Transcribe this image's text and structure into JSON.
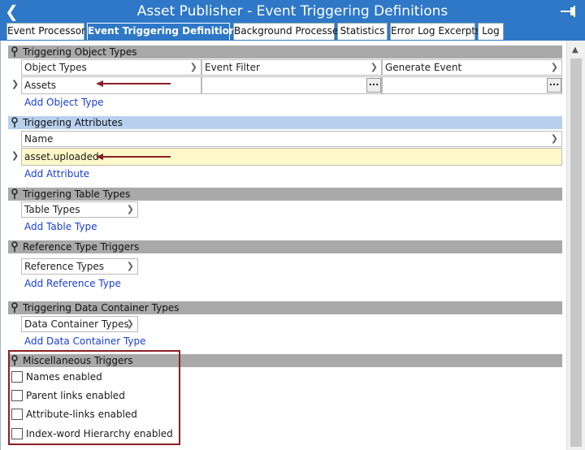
{
  "window": {
    "title": "Asset Publisher - Event Triggering Definitions"
  },
  "tabs": [
    {
      "label": "Event Processor"
    },
    {
      "label": "Event Triggering Definitions"
    },
    {
      "label": "Background Processes"
    },
    {
      "label": "Statistics"
    },
    {
      "label": "Error Log Excerpts"
    },
    {
      "label": "Log"
    }
  ],
  "sections": {
    "object_types": {
      "title": "Triggering Object Types",
      "columns": [
        "Object Types",
        "Event Filter",
        "Generate Event"
      ],
      "rows": [
        {
          "object_type": "Assets",
          "event_filter": "",
          "generate_event": ""
        }
      ],
      "dots": "...",
      "add_link": "Add Object Type"
    },
    "attributes": {
      "title": "Triggering Attributes",
      "columns": [
        "Name"
      ],
      "rows": [
        {
          "name": "asset.uploaded"
        }
      ],
      "add_link": "Add Attribute"
    },
    "table_types": {
      "title": "Triggering Table Types",
      "columns": [
        "Table Types"
      ],
      "add_link": "Add Table Type"
    },
    "reference_types": {
      "title": "Reference Type Triggers",
      "columns": [
        "Reference Types"
      ],
      "add_link": "Add Reference Type"
    },
    "data_container_types": {
      "title": "Triggering Data Container Types",
      "columns": [
        "Data Container Types"
      ],
      "add_link": "Add Data Container Type"
    },
    "misc": {
      "title": "Miscellaneous Triggers",
      "options": [
        {
          "label": "Names enabled",
          "checked": false
        },
        {
          "label": "Parent links enabled",
          "checked": false
        },
        {
          "label": "Attribute-links enabled",
          "checked": false
        },
        {
          "label": "Index-word Hierarchy enabled",
          "checked": false
        }
      ]
    }
  },
  "colors": {
    "title_bar": "#2e78c7",
    "section_header": "#a9a9a9",
    "section_header_active": "#b8d0ee",
    "selected_row": "#fff8c8",
    "link": "#1a3fd1",
    "annotation": "#8a2024"
  },
  "icons": {
    "back": "chevron-left-icon",
    "pin": "pin-icon",
    "section": "pushpin-icon"
  }
}
